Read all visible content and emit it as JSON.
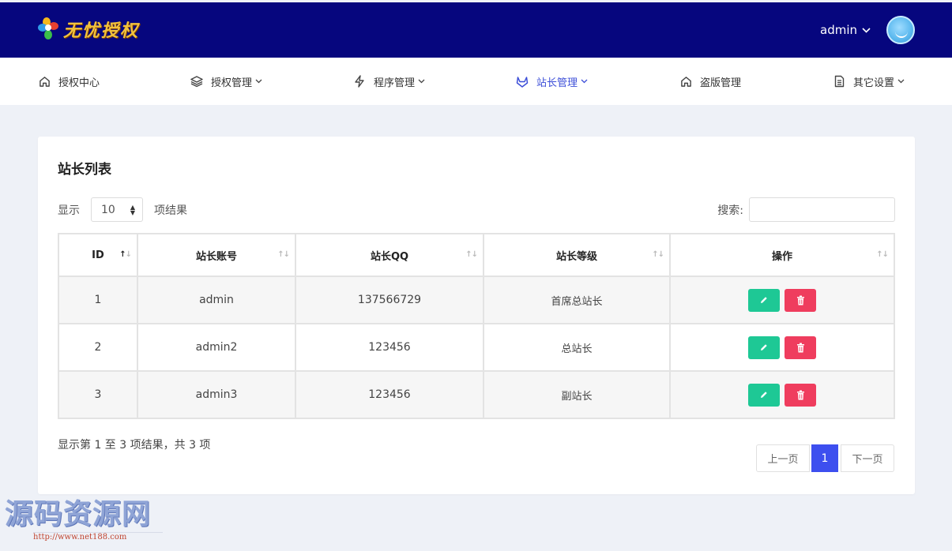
{
  "header": {
    "logo_text": "无忧授权",
    "user_name": "admin"
  },
  "nav": [
    {
      "label": "授权中心",
      "icon": "home-icon",
      "dropdown": false
    },
    {
      "label": "授权管理",
      "icon": "layers-icon",
      "dropdown": true
    },
    {
      "label": "程序管理",
      "icon": "lightning-icon",
      "dropdown": true
    },
    {
      "label": "站长管理",
      "icon": "gitlab-fox-icon",
      "dropdown": true,
      "active": true
    },
    {
      "label": "盗版管理",
      "icon": "home-icon",
      "dropdown": false
    },
    {
      "label": "其它设置",
      "icon": "document-icon",
      "dropdown": true
    }
  ],
  "card": {
    "title": "站长列表",
    "length_prefix": "显示",
    "length_value": "10",
    "length_suffix": "项结果",
    "search_label": "搜索:",
    "search_value": ""
  },
  "table": {
    "headers": [
      "ID",
      "站长账号",
      "站长QQ",
      "站长等级",
      "操作"
    ],
    "rows": [
      {
        "id": "1",
        "account": "admin",
        "qq": "137566729",
        "level": "首席总站长"
      },
      {
        "id": "2",
        "account": "admin2",
        "qq": "123456",
        "level": "总站长"
      },
      {
        "id": "3",
        "account": "admin3",
        "qq": "123456",
        "level": "副站长"
      }
    ]
  },
  "footer": {
    "info": "显示第 1 至 3 项结果，共 3 项",
    "prev": "上一页",
    "current": "1",
    "next": "下一页"
  },
  "watermark": {
    "text": "源码资源网",
    "url": "http://www.net188.com"
  },
  "colors": {
    "header_bg": "#06067e",
    "accent": "#3d4fd8",
    "edit": "#1ec895",
    "delete": "#ef3d5e"
  }
}
